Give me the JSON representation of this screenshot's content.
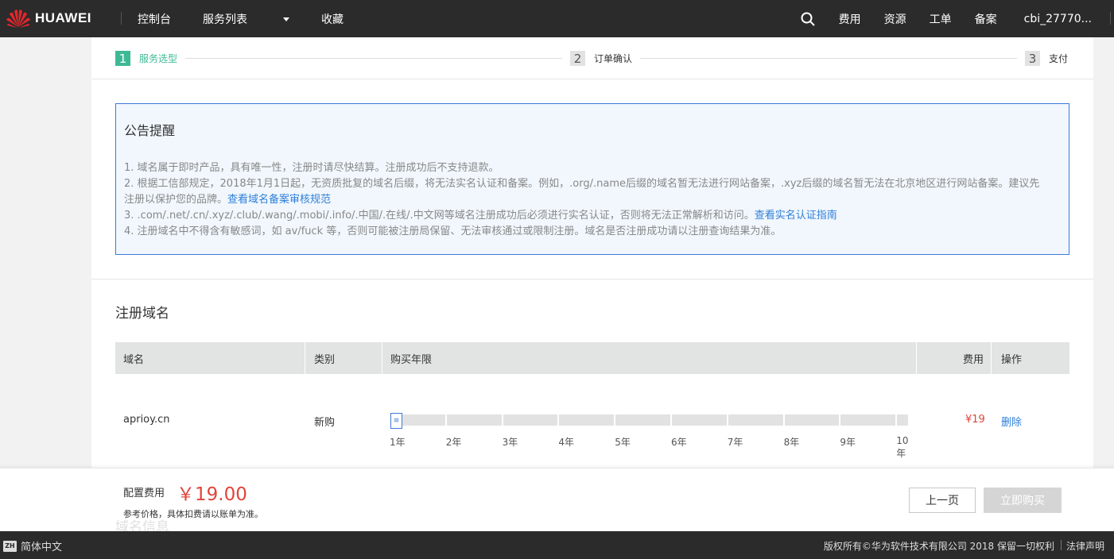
{
  "topnav": {
    "brand": "HUAWEI",
    "items": [
      "控制台",
      "服务列表",
      "收藏"
    ],
    "right_items": [
      "费用",
      "资源",
      "工单",
      "备案"
    ],
    "user": "cbi_27770..."
  },
  "steps": [
    {
      "num": "1",
      "label": "服务选型"
    },
    {
      "num": "2",
      "label": "订单确认"
    },
    {
      "num": "3",
      "label": "支付"
    }
  ],
  "notice": {
    "title": "公告提醒",
    "line1": "1. 域名属于即时产品，具有唯一性，注册时请尽快结算。注册成功后不支持退款。",
    "line2": "2. 根据工信部规定，2018年1月1日起，无资质批复的域名后缀，将无法实名认证和备案。例如，.org/.name后缀的域名暂无法进行网站备案，.xyz后缀的域名暂无法在北京地区进行网站备案。建议先注册以保护您的品牌。",
    "link2": "查看域名备案审核规范",
    "line3": "3. .com/.net/.cn/.xyz/.club/.wang/.mobi/.info/.中国/.在线/.中文网等域名注册成功后必须进行实名认证，否则将无法正常解析和访问。",
    "link3": "查看实名认证指南",
    "line4": "4. 注册域名中不得含有敏感词，如 av/fuck 等，否则可能被注册局保留、无法审核通过或限制注册。域名是否注册成功请以注册查询结果为准。"
  },
  "register": {
    "title": "注册域名",
    "headers": {
      "domain": "域名",
      "type": "类别",
      "years": "购买年限",
      "fee": "费用",
      "action": "操作"
    },
    "row": {
      "domain": "aprioy.cn",
      "type": "新购",
      "selected_years": 1,
      "fee": "¥19",
      "action": "删除"
    },
    "year_labels": [
      "1年",
      "2年",
      "3年",
      "4年",
      "5年",
      "6年",
      "7年",
      "8年",
      "9年",
      "10年"
    ]
  },
  "pricebar": {
    "ghost_title": "域名信息",
    "label": "配置费用",
    "amount": "￥19.00",
    "note": "参考价格，具体扣费请以账单为准。",
    "prev": "上一页",
    "buy": "立即购买"
  },
  "footer": {
    "lang_badge": "ZH",
    "lang": "简体中文",
    "copyright": "版权所有©华为软件技术有限公司 2018 保留一切权利",
    "legal": "法律声明"
  },
  "colors": {
    "accent_green": "#3eb996",
    "link_blue": "#2f7fd8",
    "price_red": "#e0453b",
    "nav_bg": "#2b2b2b"
  }
}
